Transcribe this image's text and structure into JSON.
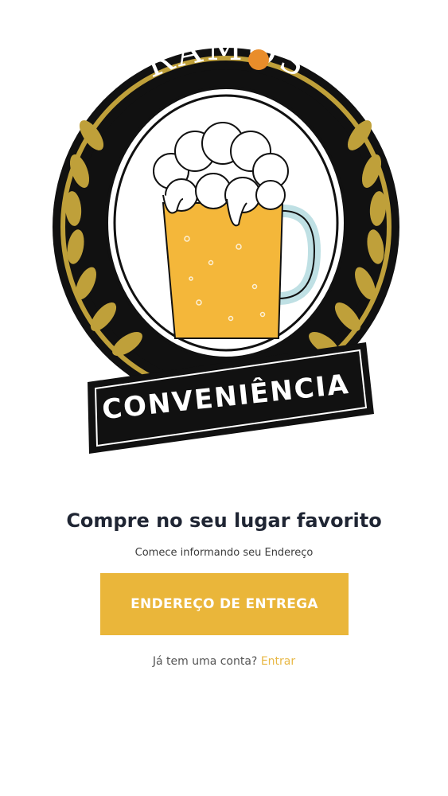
{
  "colors": {
    "brand_yellow": "#eab63a",
    "link_yellow": "#e8b845",
    "headline": "#1f2533",
    "logo_black": "#111111",
    "logo_gold": "#bfa03a",
    "beer": "#f4b73a",
    "mug_handle": "#bfe0e4"
  },
  "logo": {
    "top_text": "RAMOS",
    "banner_text": "CONVENIÊNCIA"
  },
  "main": {
    "headline": "Compre no seu lugar favorito",
    "subline": "Comece informando seu Endereço",
    "cta_label": "ENDEREÇO DE ENTREGA",
    "login_prompt": "Já tem uma conta?",
    "login_link": "Entrar"
  },
  "icons": {
    "logo_emblem": "beer-mug-emblem",
    "wheat": "wheat-icon"
  }
}
